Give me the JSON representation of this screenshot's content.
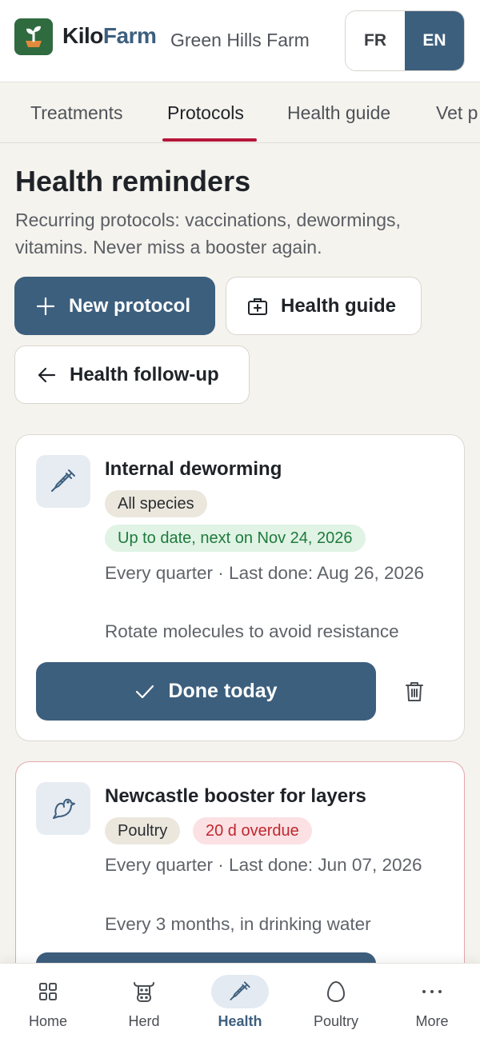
{
  "header": {
    "brand_part1": "Kilo",
    "brand_part2": "Farm",
    "farm_name": "Green Hills Farm",
    "lang_fr": "FR",
    "lang_en": "EN",
    "active_lang": "EN"
  },
  "tabs": [
    {
      "label": "Treatments",
      "active": false
    },
    {
      "label": "Protocols",
      "active": true
    },
    {
      "label": "Health guide",
      "active": false
    },
    {
      "label": "Vet p",
      "active": false
    }
  ],
  "main": {
    "title": "Health reminders",
    "subtitle": "Recurring protocols: vaccinations, dewormings, vitamins. Never miss a booster again.",
    "new_protocol_label": "New protocol",
    "health_guide_label": "Health guide",
    "follow_up_label": "Health follow-up"
  },
  "protocols": [
    {
      "icon": "syringe-icon",
      "title": "Internal deworming",
      "species": "All species",
      "status": "Up to date, next on Nov 24, 2026",
      "status_type": "ok",
      "frequency": "Every quarter · Last done: Aug 26, 2026",
      "note": "Rotate molecules to avoid resistance",
      "done_label": "Done today"
    },
    {
      "icon": "bird-icon",
      "title": "Newcastle booster for layers",
      "species": "Poultry",
      "status": "20 d overdue",
      "status_type": "overdue",
      "frequency": "Every quarter · Last done: Jun 07, 2026",
      "note": "Every 3 months, in drinking water"
    }
  ],
  "bottom_nav": [
    {
      "label": "Home",
      "icon": "grid-icon",
      "active": false
    },
    {
      "label": "Herd",
      "icon": "cow-icon",
      "active": false
    },
    {
      "label": "Health",
      "icon": "syringe-icon",
      "active": true
    },
    {
      "label": "Poultry",
      "icon": "egg-icon",
      "active": false
    },
    {
      "label": "More",
      "icon": "more-icon",
      "active": false
    }
  ],
  "colors": {
    "primary": "#3d5f7e",
    "brand_green": "#2f6b3f",
    "tab_underline": "#b5163b",
    "status_ok": "#1f7a3c",
    "status_overdue": "#c0262f",
    "background": "#f5f3ee"
  }
}
